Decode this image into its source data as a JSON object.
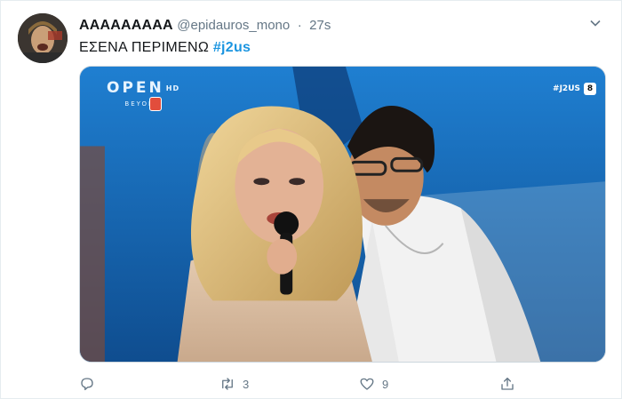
{
  "tweet": {
    "display_name": "ΑΑΑΑΑΑΑΑΑ",
    "handle": "@epidauros_mono",
    "separator": "·",
    "time": "27s",
    "text": "ΕΣΕΝΑ ΠΕΡΙΜΕΝΩ",
    "hashtag": "#j2us"
  },
  "media": {
    "channel_logo": "OPEN",
    "channel_hd": "HD",
    "channel_tagline": "BEYOND",
    "program_tag": "#J2US",
    "rating": "8"
  },
  "actions": {
    "reply_icon": "reply-icon",
    "retweet_icon": "retweet-icon",
    "retweet_count": "3",
    "like_icon": "heart-icon",
    "like_count": "9",
    "share_icon": "share-icon"
  },
  "colors": {
    "link": "#1b95e0",
    "muted": "#657786"
  }
}
